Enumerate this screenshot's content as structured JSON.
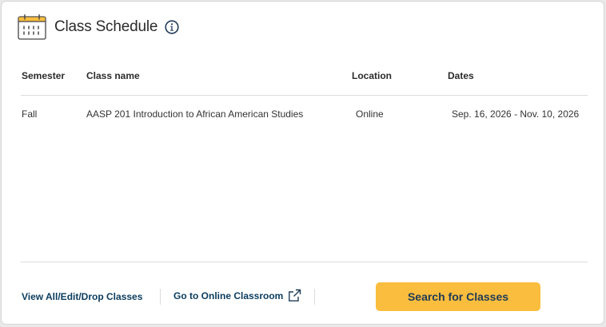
{
  "header": {
    "title": "Class Schedule",
    "calendar_icon": "calendar-icon",
    "info_icon": "info-icon"
  },
  "table": {
    "columns": [
      "Semester",
      "Class name",
      "Location",
      "Dates"
    ],
    "rows": [
      {
        "semester": "Fall",
        "class_name": "AASP 201 Introduction to African American Studies",
        "location": "Online",
        "dates": "Sep. 16, 2026 - Nov. 10, 2026"
      }
    ]
  },
  "footer": {
    "view_all_label": "View All/Edit/Drop Classes",
    "online_classroom_label": "Go to Online Classroom",
    "external_link_icon": "external-link-icon",
    "search_button_label": "Search for Classes"
  },
  "colors": {
    "accent_yellow": "#fbbd3d",
    "link_navy": "#0b3c5d",
    "button_text": "#1f3b57"
  }
}
